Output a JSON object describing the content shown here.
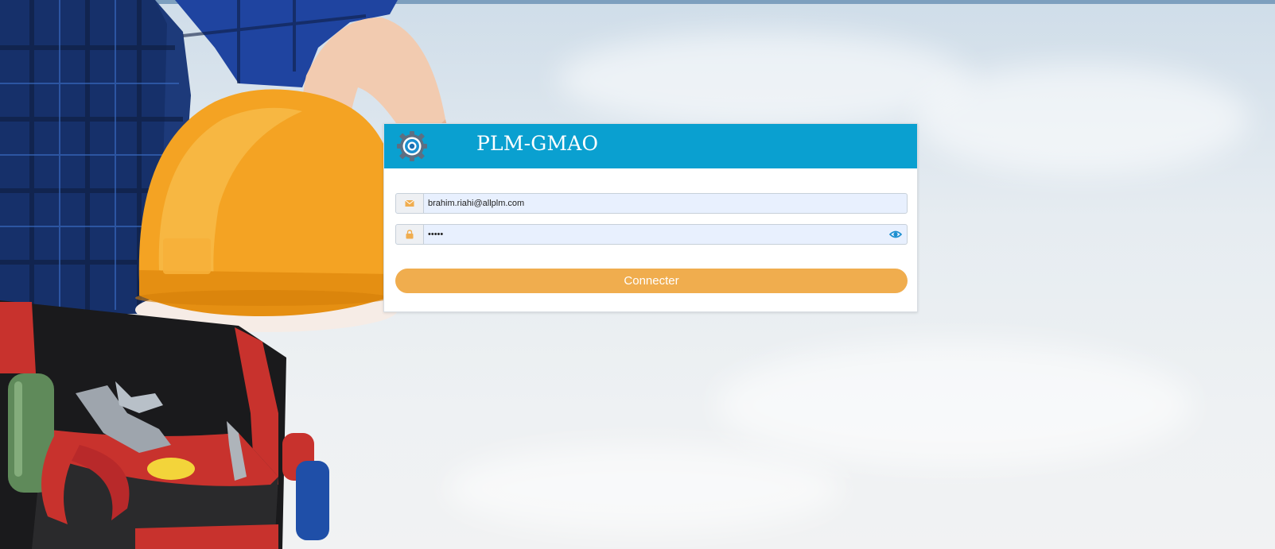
{
  "app": {
    "title": "PLM-GMAO",
    "header_color": "#0aa0d0",
    "accent_color": "#f0ad4e"
  },
  "login": {
    "email": {
      "value": "brahim.riahi@allplm.com",
      "icon": "envelope-icon"
    },
    "password": {
      "value": "•••••",
      "icon": "lock-icon",
      "toggle_icon": "eye-icon"
    },
    "submit_label": "Connecter"
  },
  "background": {
    "description_icon": "worker-hardhat-photo"
  }
}
